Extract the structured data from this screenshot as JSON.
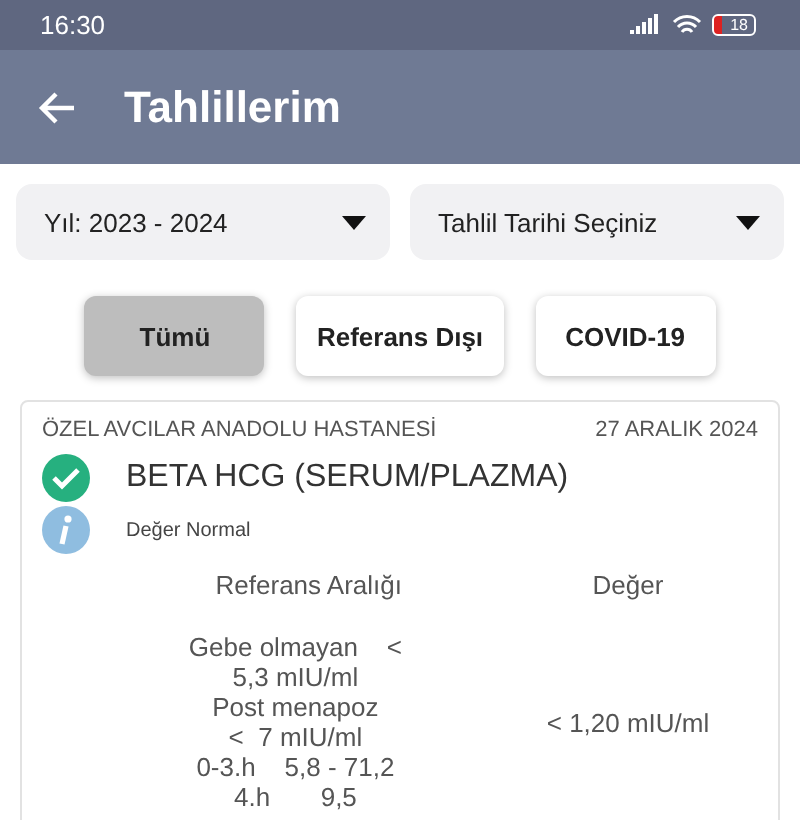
{
  "status_bar": {
    "time": "16:30",
    "battery": "18"
  },
  "app_bar": {
    "title": "Tahlillerim"
  },
  "filters": [
    {
      "label": "Yıl: 2023 - 2024"
    },
    {
      "label": "Tahlil Tarihi Seçiniz"
    }
  ],
  "tabs": [
    {
      "label": "Tümü",
      "selected": true
    },
    {
      "label": "Referans Dışı",
      "selected": false
    },
    {
      "label": "COVID-19",
      "selected": false
    }
  ],
  "results": [
    {
      "hospital": "ÖZEL AVCILAR ANADOLU HASTANESİ",
      "date": "27 ARALIK 2024",
      "test": "BETA HCG (SERUM/PLAZMA)",
      "status": "Değer Normal",
      "reference_header": "Referans Aralığı",
      "value_header": "Değer",
      "reference_lines": [
        "Gebe olmayan    <",
        "5,3 mIU/ml",
        "Post menapoz",
        "<  7 mIU/ml",
        "0-3.h    5,8 - 71,2",
        "4.h       9,5"
      ],
      "value": "< 1,20 mIU/ml"
    }
  ]
}
